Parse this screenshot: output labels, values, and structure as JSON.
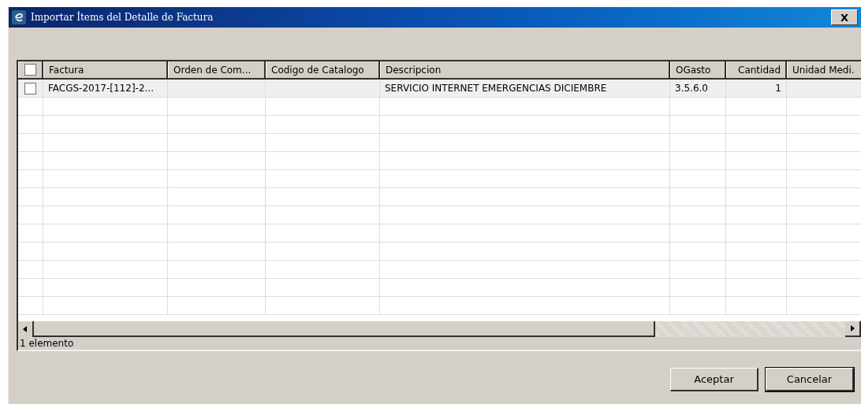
{
  "window": {
    "title": "Importar Ítems del Detalle de Factura",
    "close_label": "X"
  },
  "table": {
    "select_all": {
      "checked": false
    },
    "columns": [
      {
        "label": "Factura",
        "kind": "text"
      },
      {
        "label": "Orden de Com...",
        "kind": "text"
      },
      {
        "label": "Codigo de Catalogo",
        "kind": "text"
      },
      {
        "label": "Descripcion",
        "kind": "text"
      },
      {
        "label": "OGasto",
        "kind": "text"
      },
      {
        "label": "Cantidad",
        "kind": "number"
      },
      {
        "label": "Unidad Medi.",
        "kind": "text"
      }
    ],
    "rows": [
      {
        "checked": false,
        "selected": true,
        "cells": [
          "FACGS-2017-[112]-2...",
          "",
          "",
          "SERVICIO INTERNET EMERGENCIAS DICIEMBRE",
          "3.5.6.0",
          "1",
          ""
        ]
      }
    ]
  },
  "status_bar": "1 elemento",
  "buttons": [
    {
      "label": "Aceptar",
      "default": false
    },
    {
      "label": "Cancelar",
      "default": true
    }
  ]
}
